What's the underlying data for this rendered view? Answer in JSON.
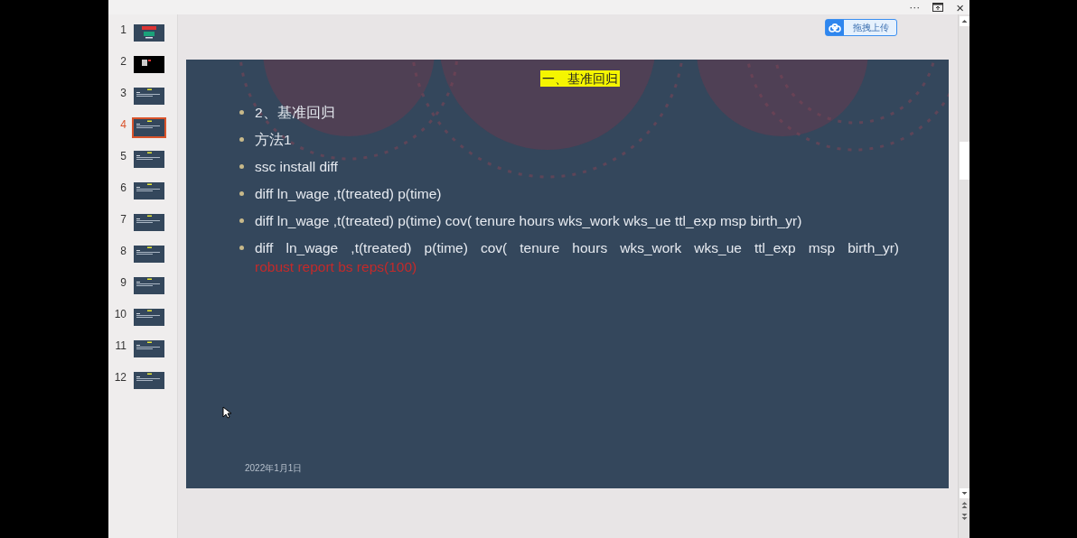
{
  "title_bar": {
    "more": "···",
    "close": "×"
  },
  "slides": [
    {
      "number": "1",
      "kind": "title",
      "selected": false
    },
    {
      "number": "2",
      "kind": "dark",
      "selected": false
    },
    {
      "number": "3",
      "kind": "content",
      "selected": false
    },
    {
      "number": "4",
      "kind": "content",
      "selected": true
    },
    {
      "number": "5",
      "kind": "content",
      "selected": false
    },
    {
      "number": "6",
      "kind": "content",
      "selected": false
    },
    {
      "number": "7",
      "kind": "content",
      "selected": false
    },
    {
      "number": "8",
      "kind": "content",
      "selected": false
    },
    {
      "number": "9",
      "kind": "content",
      "selected": false
    },
    {
      "number": "10",
      "kind": "content",
      "selected": false
    },
    {
      "number": "11",
      "kind": "content",
      "selected": false
    },
    {
      "number": "12",
      "kind": "content",
      "selected": false
    }
  ],
  "upload_button": {
    "label": "拖拽上传"
  },
  "slide": {
    "title": "一、基准回归",
    "bullets": [
      {
        "text": "2、基准回归"
      },
      {
        "text": "方法1"
      },
      {
        "text": "ssc install diff"
      },
      {
        "text": "diff ln_wage ,t(treated) p(time)"
      },
      {
        "text": "diff ln_wage ,t(treated) p(time) cov( tenure hours wks_work wks_ue ttl_exp msp birth_yr)"
      },
      {
        "text": "diff ln_wage ,t(treated) p(time) cov( tenure hours wks_work wks_ue ttl_exp msp birth_yr)",
        "highlight": "robust report bs reps(100)",
        "color": "#c42a2a"
      }
    ],
    "date": "2022年1月1日"
  }
}
